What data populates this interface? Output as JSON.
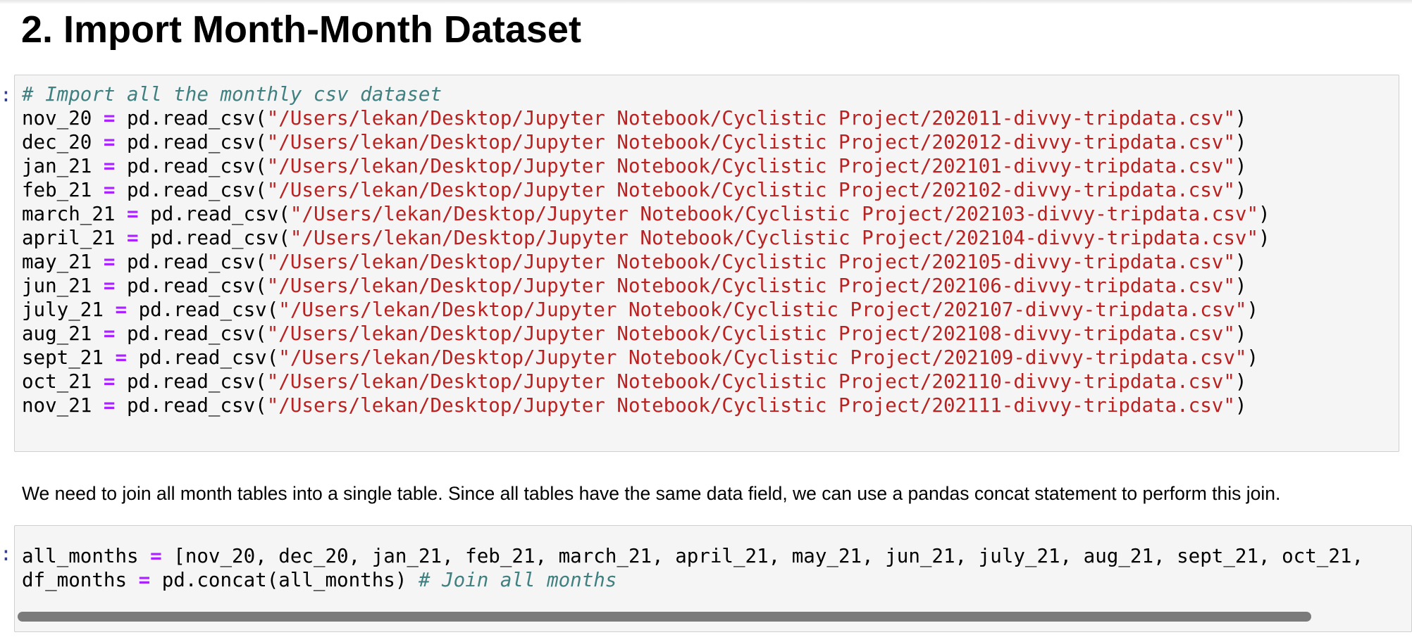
{
  "heading": "2. Import Month-Month Dataset",
  "prompt_glyph": ":",
  "cell1": {
    "comment": "# Import all the monthly csv dataset",
    "func": "pd.read_csv(",
    "close": ")",
    "lines": [
      {
        "var": "nov_20",
        "path": "\"/Users/lekan/Desktop/Jupyter Notebook/Cyclistic Project/202011-divvy-tripdata.csv\""
      },
      {
        "var": "dec_20",
        "path": "\"/Users/lekan/Desktop/Jupyter Notebook/Cyclistic Project/202012-divvy-tripdata.csv\""
      },
      {
        "var": "jan_21",
        "path": "\"/Users/lekan/Desktop/Jupyter Notebook/Cyclistic Project/202101-divvy-tripdata.csv\""
      },
      {
        "var": "feb_21",
        "path": "\"/Users/lekan/Desktop/Jupyter Notebook/Cyclistic Project/202102-divvy-tripdata.csv\""
      },
      {
        "var": "march_21",
        "path": "\"/Users/lekan/Desktop/Jupyter Notebook/Cyclistic Project/202103-divvy-tripdata.csv\""
      },
      {
        "var": "april_21",
        "path": "\"/Users/lekan/Desktop/Jupyter Notebook/Cyclistic Project/202104-divvy-tripdata.csv\""
      },
      {
        "var": "may_21",
        "path": "\"/Users/lekan/Desktop/Jupyter Notebook/Cyclistic Project/202105-divvy-tripdata.csv\""
      },
      {
        "var": "jun_21",
        "path": "\"/Users/lekan/Desktop/Jupyter Notebook/Cyclistic Project/202106-divvy-tripdata.csv\""
      },
      {
        "var": "july_21",
        "path": "\"/Users/lekan/Desktop/Jupyter Notebook/Cyclistic Project/202107-divvy-tripdata.csv\""
      },
      {
        "var": "aug_21",
        "path": "\"/Users/lekan/Desktop/Jupyter Notebook/Cyclistic Project/202108-divvy-tripdata.csv\""
      },
      {
        "var": "sept_21",
        "path": "\"/Users/lekan/Desktop/Jupyter Notebook/Cyclistic Project/202109-divvy-tripdata.csv\""
      },
      {
        "var": "oct_21",
        "path": "\"/Users/lekan/Desktop/Jupyter Notebook/Cyclistic Project/202110-divvy-tripdata.csv\""
      },
      {
        "var": "nov_21",
        "path": "\"/Users/lekan/Desktop/Jupyter Notebook/Cyclistic Project/202111-divvy-tripdata.csv\""
      }
    ]
  },
  "markdown_text": "We need to join all month tables into a single table. Since all tables have the same data field, we can use a pandas concat statement to perform this join.",
  "cell2": {
    "line1_var": "all_months",
    "line1_rest": "[nov_20, dec_20, jan_21, feb_21, march_21, april_21, may_21, jun_21, july_21, aug_21, sept_21, oct_21,",
    "line2_var": "df_months",
    "line2_expr": "pd.concat(all_months)",
    "line2_comment": "# Join all months"
  },
  "colors": {
    "comment": "#408080",
    "operator": "#aa22ff",
    "string": "#ba2121",
    "cell_background": "#f5f5f5",
    "prompt": "#303f9f"
  },
  "icons": [
    "horizontal-scrollbar"
  ]
}
